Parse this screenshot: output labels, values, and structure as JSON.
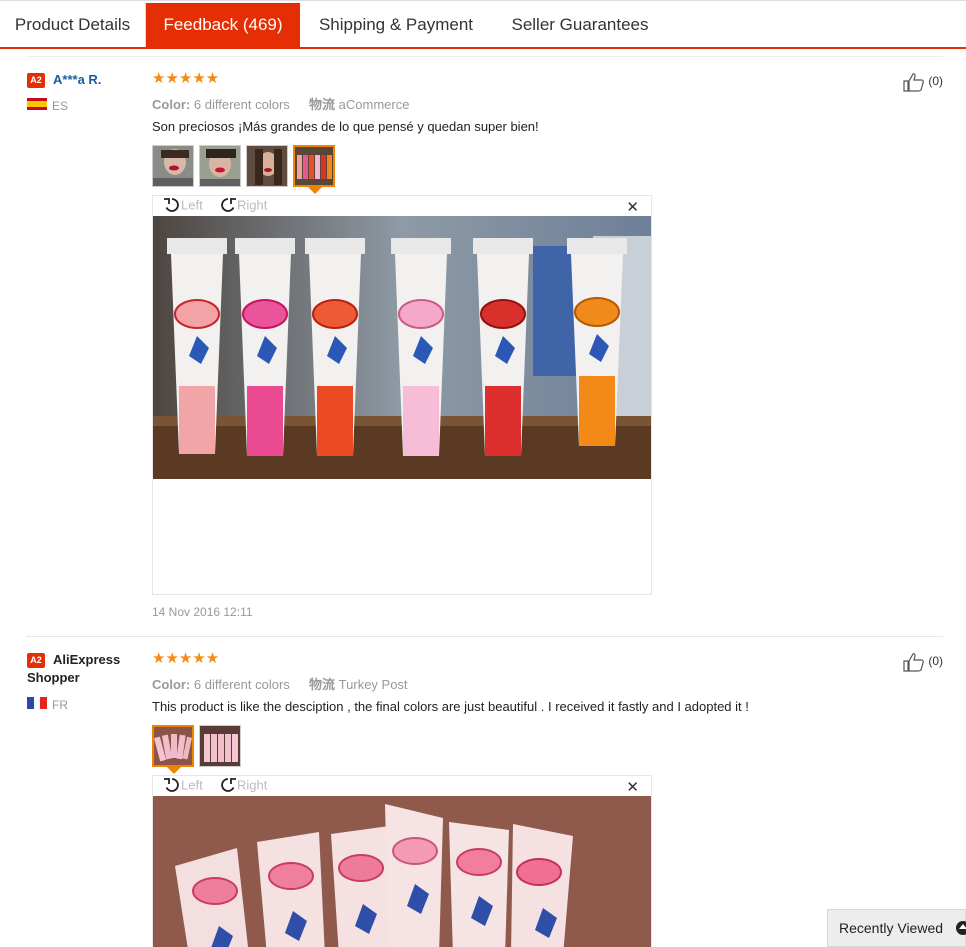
{
  "tabs": [
    {
      "label": "Product Details",
      "active": false
    },
    {
      "label": "Feedback (469)",
      "active": true
    },
    {
      "label": "Shipping & Payment",
      "active": false
    },
    {
      "label": "Seller Guarantees",
      "active": false
    }
  ],
  "reviews": [
    {
      "badge": "A2",
      "user": "A***a R.",
      "country": "ES",
      "stars": "★★★★★",
      "color_label": "Color:",
      "color_value": "6 different colors",
      "shipping_label": "物流",
      "shipping_value": "aCommerce",
      "text": "Son preciosos ¡Más grandes de lo que pensé y quedan super bien!",
      "date": "14 Nov 2016 12:11",
      "likes": "(0)",
      "viewer": {
        "left_label": "Left",
        "right_label": "Right",
        "close": "✕"
      }
    },
    {
      "badge": "A2",
      "user_line1": "AliExpress",
      "user_line2": "Shopper",
      "country": "FR",
      "stars": "★★★★★",
      "color_label": "Color:",
      "color_value": "6 different colors",
      "shipping_label": "物流",
      "shipping_value": "Turkey Post",
      "text": "This product is like the desciption , the final colors are just beautiful . I received it fastly and I adopted it !",
      "likes": "(0)",
      "viewer": {
        "left_label": "Left",
        "right_label": "Right",
        "close": "✕"
      }
    }
  ],
  "recently_viewed": "Recently Viewed",
  "colors": {
    "accent": "#e62e04",
    "star": "#f58c11",
    "link": "#1a5d9e",
    "selected_thumb": "#f08300"
  }
}
